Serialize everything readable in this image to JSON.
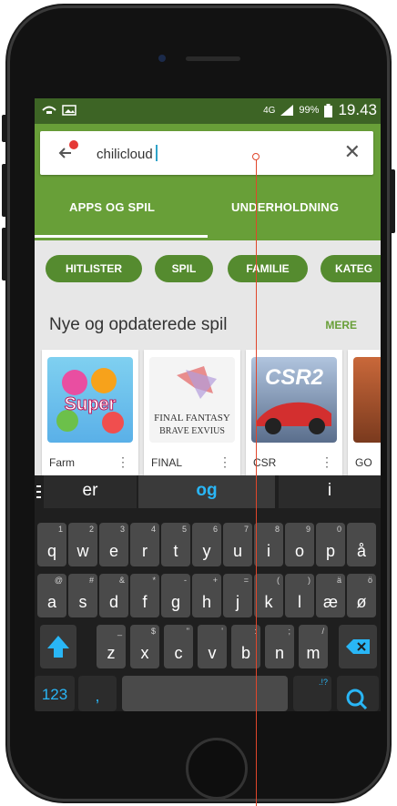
{
  "status_bar": {
    "network": "4G",
    "battery": "99%",
    "time": "19.43"
  },
  "search": {
    "query": "chilicloud"
  },
  "tabs": [
    "APPS OG SPIL",
    "UNDERHOLDNING"
  ],
  "chips": [
    "HITLISTER",
    "SPIL",
    "FAMILIE",
    "KATEG"
  ],
  "section": {
    "title": "Nye og opdaterede spil",
    "more": "MERE"
  },
  "apps": [
    {
      "name": "Farm",
      "icon": "super-icon"
    },
    {
      "name": "FINAL",
      "icon": "final-fantasy-icon"
    },
    {
      "name": "CSR",
      "icon": "csr2-icon"
    },
    {
      "name": "GO",
      "icon": "partial-icon"
    }
  ],
  "app_art": {
    "super_text": "Super",
    "ff_line1": "FINAL FANTASY",
    "ff_line2": "BRAVE EXVIUS",
    "csr_text": "CSR2"
  },
  "keyboard": {
    "suggestions": [
      "er",
      "og",
      "i"
    ],
    "row1": [
      {
        "hint": "1",
        "main": "q"
      },
      {
        "hint": "2",
        "main": "w"
      },
      {
        "hint": "3",
        "main": "e"
      },
      {
        "hint": "4",
        "main": "r"
      },
      {
        "hint": "5",
        "main": "t"
      },
      {
        "hint": "6",
        "main": "y"
      },
      {
        "hint": "7",
        "main": "u"
      },
      {
        "hint": "8",
        "main": "i"
      },
      {
        "hint": "9",
        "main": "o"
      },
      {
        "hint": "0",
        "main": "p"
      },
      {
        "hint": "",
        "main": "å"
      }
    ],
    "row2": [
      {
        "hint": "@",
        "main": "a"
      },
      {
        "hint": "#",
        "main": "s"
      },
      {
        "hint": "&",
        "main": "d"
      },
      {
        "hint": "*",
        "main": "f"
      },
      {
        "hint": "-",
        "main": "g"
      },
      {
        "hint": "+",
        "main": "h"
      },
      {
        "hint": "=",
        "main": "j"
      },
      {
        "hint": "(",
        "main": "k"
      },
      {
        "hint": ")",
        "main": "l"
      },
      {
        "hint": "ä",
        "main": "æ"
      },
      {
        "hint": "ö",
        "main": "ø"
      }
    ],
    "row3": [
      {
        "hint": "_",
        "main": "z"
      },
      {
        "hint": "$",
        "main": "x"
      },
      {
        "hint": "\"",
        "main": "c"
      },
      {
        "hint": "'",
        "main": "v"
      },
      {
        "hint": ":",
        "main": "b"
      },
      {
        "hint": ";",
        "main": "n"
      },
      {
        "hint": "/",
        "main": "m"
      }
    ],
    "numbers_key": "123"
  },
  "colors": {
    "status_bar": "#3d6425",
    "accent": "#689f38",
    "chip": "#558b2f",
    "keyboard_accent": "#29b6f6"
  }
}
